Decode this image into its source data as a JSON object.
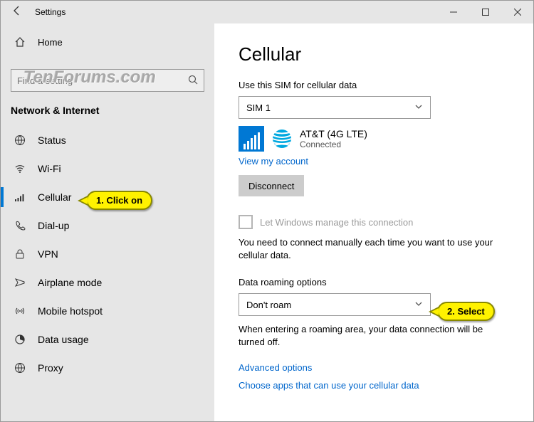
{
  "window": {
    "title": "Settings"
  },
  "sidebar": {
    "home_label": "Home",
    "search_placeholder": "Find a setting",
    "category": "Network & Internet",
    "items": [
      {
        "label": "Status"
      },
      {
        "label": "Wi-Fi"
      },
      {
        "label": "Cellular"
      },
      {
        "label": "Dial-up"
      },
      {
        "label": "VPN"
      },
      {
        "label": "Airplane mode"
      },
      {
        "label": "Mobile hotspot"
      },
      {
        "label": "Data usage"
      },
      {
        "label": "Proxy"
      }
    ]
  },
  "main": {
    "title": "Cellular",
    "sim_section_label": "Use this SIM for cellular data",
    "sim_selected": "SIM 1",
    "carrier_name": "AT&T (4G LTE)",
    "carrier_state": "Connected",
    "view_account": "View my account",
    "disconnect_label": "Disconnect",
    "auto_manage_label": "Let Windows manage this connection",
    "manual_desc": "You need to connect manually each time you want to use your cellular data.",
    "roam_label": "Data roaming options",
    "roam_selected": "Don't roam",
    "roam_desc": "When entering a roaming area, your data connection will be turned off.",
    "advanced_link": "Advanced options",
    "choose_apps_link": "Choose apps that can use your cellular data"
  },
  "callouts": {
    "c1": "1. Click on",
    "c2": "2. Select"
  },
  "watermark": "TenForums.com"
}
